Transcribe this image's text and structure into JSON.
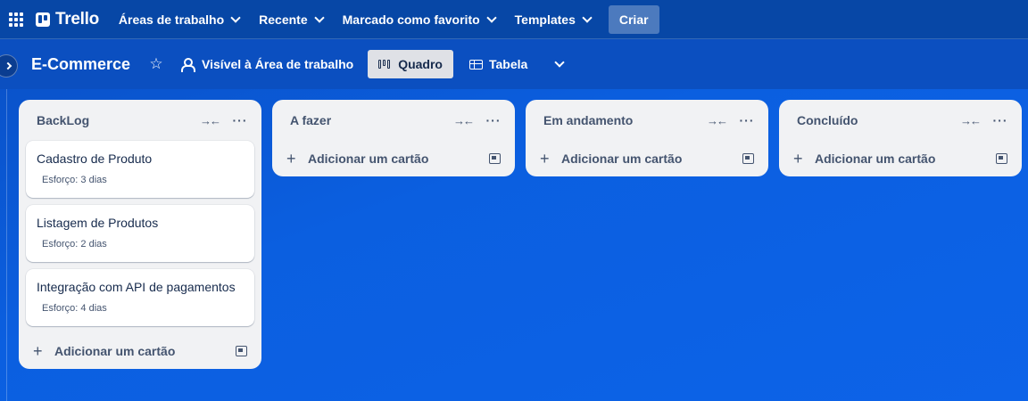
{
  "topbar": {
    "logo": "Trello",
    "nav": [
      "Áreas de trabalho",
      "Recente",
      "Marcado como favorito",
      "Templates"
    ],
    "create_label": "Criar"
  },
  "board": {
    "title": "E-Commerce",
    "visibility": "Visível à Área de trabalho",
    "views": [
      "Quadro",
      "Tabela"
    ],
    "active_view": "Quadro"
  },
  "add_card_label": "Adicionar um cartão",
  "lists": [
    {
      "title": "BackLog",
      "cards": [
        {
          "title": "Cadastro de Produto",
          "badge": "Esforço: 3 dias"
        },
        {
          "title": "Listagem de Produtos",
          "badge": "Esforço: 2 dias"
        },
        {
          "title": "Integração com API de pagamentos",
          "badge": "Esforço: 4 dias"
        }
      ]
    },
    {
      "title": "A fazer",
      "cards": []
    },
    {
      "title": "Em andamento",
      "cards": []
    },
    {
      "title": "Concluído",
      "cards": []
    }
  ],
  "colors": {
    "topbar": "#0747a6",
    "board_bg": "#0b5fe0",
    "list_bg": "#f1f2f4"
  }
}
